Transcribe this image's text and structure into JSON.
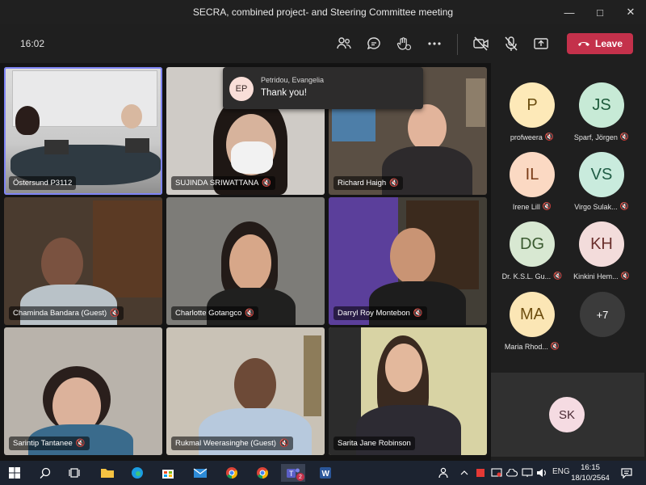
{
  "window": {
    "title": "SECRA, combined project- and Steering Committee meeting"
  },
  "toolbar": {
    "timer": "16:02",
    "leave_label": "Leave"
  },
  "toast": {
    "initials": "EP",
    "sender": "Petridou, Evangelia",
    "message": "Thank you!"
  },
  "tiles": [
    {
      "name": "Östersund P3112",
      "muted": false
    },
    {
      "name": "SUJINDA SRIWATTANA",
      "muted": true
    },
    {
      "name": "Richard Haigh",
      "muted": true
    },
    {
      "name": "Chaminda Bandara (Guest)",
      "muted": true
    },
    {
      "name": "Charlotte Gotangco",
      "muted": true
    },
    {
      "name": "Darryl Roy Montebon",
      "muted": true
    },
    {
      "name": "Sarintip Tantanee",
      "muted": true
    },
    {
      "name": "Rukmal Weerasinghe (Guest)",
      "muted": true
    },
    {
      "name": "Sarita Jane Robinson",
      "muted": false
    }
  ],
  "roster": [
    {
      "initials": "P",
      "name": "profweera",
      "bg": "#fde9b8",
      "fg": "#6a4d10"
    },
    {
      "initials": "JS",
      "name": "Sparf, Jörgen",
      "bg": "#c7ead6",
      "fg": "#1d5a3a"
    },
    {
      "initials": "IL",
      "name": "Irene Lill",
      "bg": "#fbd9c3",
      "fg": "#7a3c17"
    },
    {
      "initials": "VS",
      "name": "Virgo Sulak...",
      "bg": "#c9ebdd",
      "fg": "#1f5c44"
    },
    {
      "initials": "DG",
      "name": "Dr. K.S.L. Gu...",
      "bg": "#d8e8d2",
      "fg": "#3a5a30"
    },
    {
      "initials": "KH",
      "name": "Kinkini Hem...",
      "bg": "#f3dcdb",
      "fg": "#6a2f2c"
    },
    {
      "initials": "MA",
      "name": "Maria Rhod...",
      "bg": "#fbe6b5",
      "fg": "#6e4e10"
    }
  ],
  "overflow_count": "+7",
  "self_view": {
    "initials": "SK"
  },
  "taskbar": {
    "teams_badge": "2",
    "language": "ENG",
    "time": "16:15",
    "date": "18/10/2564"
  },
  "colors": {
    "leave": "#c4314b",
    "active_speaker": "#7f85f5",
    "taskbar": "#1c2330"
  }
}
